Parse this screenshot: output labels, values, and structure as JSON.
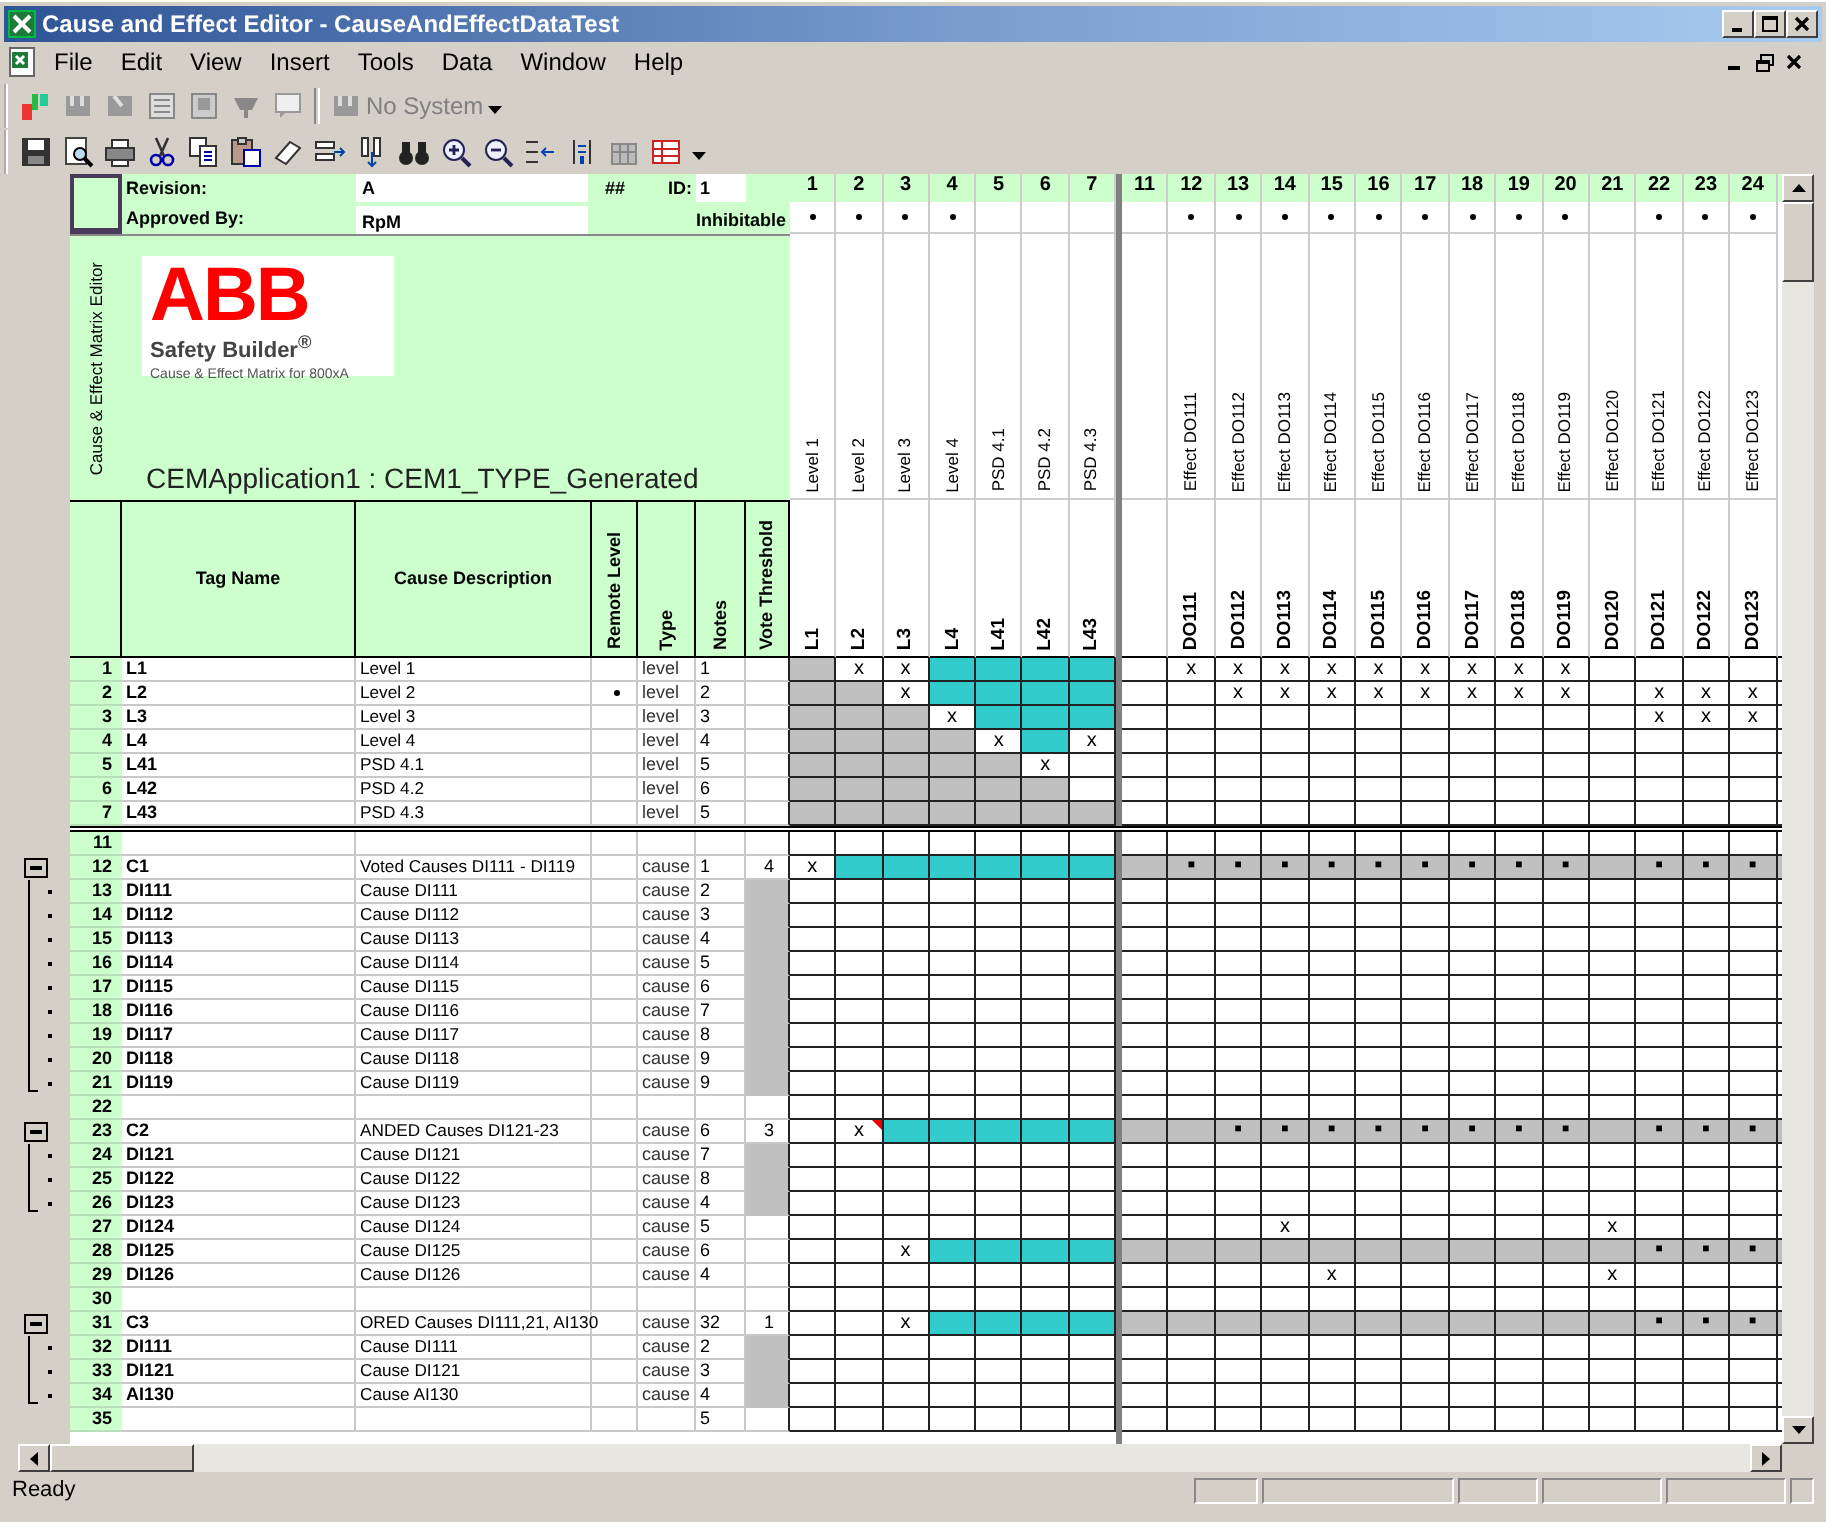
{
  "window": {
    "title": "Cause and Effect Editor - CauseAndEffectDataTest"
  },
  "menu": [
    "File",
    "Edit",
    "View",
    "Insert",
    "Tools",
    "Data",
    "Window",
    "Help"
  ],
  "toolbar": {
    "system_selector": "No System"
  },
  "sheet": {
    "revision_label": "Revision:",
    "revision": "A",
    "hash_mark": "##",
    "id_label": "ID:",
    "id": "1",
    "approved_label": "Approved By:",
    "approved_by": "RpM",
    "inhibitable_label": "Inhibitable",
    "side_caption": "Cause & Effect Matrix Editor",
    "logo": {
      "mark": "ABB",
      "product": "Safety Builder$^{®}$",
      "tagline": "Cause & Effect Matrix for 800xA"
    },
    "application_title": "CEMApplication1 : CEM1_TYPE_Generated",
    "columns": [
      "Tag Name",
      "Cause Description",
      "Remote Level",
      "Type",
      "Notes",
      "Vote Threshold"
    ],
    "cause_columns": [
      {
        "number": "1",
        "inhibitable": true,
        "description": "Level 1",
        "tag": "L1"
      },
      {
        "number": "2",
        "inhibitable": true,
        "description": "Level 2",
        "tag": "L2"
      },
      {
        "number": "3",
        "inhibitable": true,
        "description": "Level 3",
        "tag": "L3"
      },
      {
        "number": "4",
        "inhibitable": true,
        "description": "Level 4",
        "tag": "L4"
      },
      {
        "number": "5",
        "inhibitable": false,
        "description": "PSD 4.1",
        "tag": "L41"
      },
      {
        "number": "6",
        "inhibitable": false,
        "description": "PSD 4.2",
        "tag": "L42"
      },
      {
        "number": "7",
        "inhibitable": false,
        "description": "PSD 4.3",
        "tag": "L43"
      }
    ],
    "effect_columns": [
      {
        "number": "11",
        "inhibitable": false
      },
      {
        "number": "12",
        "inhibitable": true,
        "description": "Effect DO111",
        "tag": "DO111"
      },
      {
        "number": "13",
        "inhibitable": true,
        "description": "Effect DO112",
        "tag": "DO112"
      },
      {
        "number": "14",
        "inhibitable": true,
        "description": "Effect DO113",
        "tag": "DO113"
      },
      {
        "number": "15",
        "inhibitable": true,
        "description": "Effect DO114",
        "tag": "DO114"
      },
      {
        "number": "16",
        "inhibitable": true,
        "description": "Effect DO115",
        "tag": "DO115"
      },
      {
        "number": "17",
        "inhibitable": true,
        "description": "Effect DO116",
        "tag": "DO116"
      },
      {
        "number": "18",
        "inhibitable": true,
        "description": "Effect DO117",
        "tag": "DO117"
      },
      {
        "number": "19",
        "inhibitable": true,
        "description": "Effect DO118",
        "tag": "DO118"
      },
      {
        "number": "20",
        "inhibitable": true,
        "description": "Effect DO119",
        "tag": "DO119"
      },
      {
        "number": "21",
        "inhibitable": false,
        "description": "Effect DO120",
        "tag": "DO120"
      },
      {
        "number": "22",
        "inhibitable": true,
        "description": "Effect DO121",
        "tag": "DO121"
      },
      {
        "number": "23",
        "inhibitable": true,
        "description": "Effect DO122",
        "tag": "DO122"
      },
      {
        "number": "24",
        "inhibitable": true,
        "description": "Effect DO123",
        "tag": "DO123"
      }
    ],
    "level_rows": [
      {
        "number": "1",
        "tag": "L1",
        "description": "Level 1",
        "remote": false,
        "type": "level",
        "notes": "1",
        "vote_shaded": false,
        "effects_shaded": false,
        "cells": [
          {
            "color": "#c0c0c0"
          },
          "x",
          "x",
          {
            "color": "#33cccc"
          },
          {
            "color": "#33cccc"
          },
          {
            "color": "#33cccc"
          },
          {
            "color": "#33cccc"
          },
          null,
          "x",
          "x",
          "x",
          "x",
          "x",
          "x",
          "x",
          "x",
          "x"
        ]
      },
      {
        "number": "2",
        "tag": "L2",
        "description": "Level 2",
        "remote": true,
        "type": "level",
        "notes": "2",
        "vote_shaded": false,
        "effects_shaded": false,
        "cells": [
          {
            "color": "#c0c0c0"
          },
          {
            "color": "#c0c0c0"
          },
          "x",
          {
            "color": "#33cccc"
          },
          {
            "color": "#33cccc"
          },
          {
            "color": "#33cccc"
          },
          {
            "color": "#33cccc"
          },
          null,
          null,
          "x",
          "x",
          "x",
          "x",
          "x",
          "x",
          "x",
          "x",
          null,
          "x",
          "x",
          "x"
        ]
      },
      {
        "number": "3",
        "tag": "L3",
        "description": "Level 3",
        "remote": false,
        "type": "level",
        "notes": "3",
        "vote_shaded": false,
        "effects_shaded": false,
        "cells": [
          {
            "color": "#c0c0c0"
          },
          {
            "color": "#c0c0c0"
          },
          {
            "color": "#c0c0c0"
          },
          "x",
          {
            "color": "#33cccc"
          },
          {
            "color": "#33cccc"
          },
          {
            "color": "#33cccc"
          },
          null,
          null,
          null,
          null,
          null,
          null,
          null,
          null,
          null,
          null,
          null,
          "x",
          "x",
          "x"
        ]
      },
      {
        "number": "4",
        "tag": "L4",
        "description": "Level 4",
        "remote": false,
        "type": "level",
        "notes": "4",
        "vote_shaded": false,
        "effects_shaded": false,
        "cells": [
          {
            "color": "#c0c0c0"
          },
          {
            "color": "#c0c0c0"
          },
          {
            "color": "#c0c0c0"
          },
          {
            "color": "#c0c0c0"
          },
          "x",
          {
            "color": "#33cccc"
          },
          "x"
        ]
      },
      {
        "number": "5",
        "tag": "L41",
        "description": "PSD 4.1",
        "remote": false,
        "type": "level",
        "notes": "5",
        "vote_shaded": false,
        "effects_shaded": false,
        "cells": [
          {
            "color": "#c0c0c0"
          },
          {
            "color": "#c0c0c0"
          },
          {
            "color": "#c0c0c0"
          },
          {
            "color": "#c0c0c0"
          },
          {
            "color": "#c0c0c0"
          },
          "x"
        ]
      },
      {
        "number": "6",
        "tag": "L42",
        "description": "PSD 4.2",
        "remote": false,
        "type": "level",
        "notes": "6",
        "vote_shaded": false,
        "effects_shaded": false,
        "cells": [
          {
            "color": "#c0c0c0"
          },
          {
            "color": "#c0c0c0"
          },
          {
            "color": "#c0c0c0"
          },
          {
            "color": "#c0c0c0"
          },
          {
            "color": "#c0c0c0"
          },
          {
            "color": "#c0c0c0"
          }
        ]
      },
      {
        "number": "7",
        "tag": "L43",
        "description": "PSD 4.3",
        "remote": false,
        "type": "level",
        "notes": "5",
        "vote_shaded": false,
        "effects_shaded": false,
        "cells": [
          {
            "color": "#c0c0c0"
          },
          {
            "color": "#c0c0c0"
          },
          {
            "color": "#c0c0c0"
          },
          {
            "color": "#c0c0c0"
          },
          {
            "color": "#c0c0c0"
          },
          {
            "color": "#c0c0c0"
          },
          {
            "color": "#c0c0c0"
          }
        ]
      }
    ],
    "cause_rows": [
      {
        "number": "11",
        "remote": false,
        "vote_shaded": false,
        "effects_shaded": false
      },
      {
        "number": "12",
        "tag": "C1",
        "description": "Voted Causes DI111 - DI119",
        "remote": false,
        "type": "cause",
        "notes": "1",
        "vote": "4",
        "vote_shaded": false,
        "effects_shaded": true,
        "expanded": true,
        "cells": [
          "x",
          {
            "color": "#33cccc"
          },
          {
            "color": "#33cccc"
          },
          {
            "color": "#33cccc"
          },
          {
            "color": "#33cccc"
          },
          {
            "color": "#33cccc"
          },
          {
            "color": "#33cccc"
          },
          null,
          "■",
          "■",
          "■",
          "■",
          "■",
          "■",
          "■",
          "■",
          "■",
          null,
          "■",
          "■",
          "■"
        ],
        "children": [
          {
            "number": "13",
            "tag": "DI111",
            "description": "Cause DI111",
            "remote": false,
            "type": "cause",
            "notes": "2",
            "vote_shaded": true,
            "effects_shaded": false
          },
          {
            "number": "14",
            "tag": "DI112",
            "description": "Cause DI112",
            "remote": false,
            "type": "cause",
            "notes": "3",
            "vote_shaded": true,
            "effects_shaded": false
          },
          {
            "number": "15",
            "tag": "DI113",
            "description": "Cause DI113",
            "remote": false,
            "type": "cause",
            "notes": "4",
            "vote_shaded": true,
            "effects_shaded": false
          },
          {
            "number": "16",
            "tag": "DI114",
            "description": "Cause DI114",
            "remote": false,
            "type": "cause",
            "notes": "5",
            "vote_shaded": true,
            "effects_shaded": false
          },
          {
            "number": "17",
            "tag": "DI115",
            "description": "Cause DI115",
            "remote": false,
            "type": "cause",
            "notes": "6",
            "vote_shaded": true,
            "effects_shaded": false
          },
          {
            "number": "18",
            "tag": "DI116",
            "description": "Cause DI116",
            "remote": false,
            "type": "cause",
            "notes": "7",
            "vote_shaded": true,
            "effects_shaded": false
          },
          {
            "number": "19",
            "tag": "DI117",
            "description": "Cause DI117",
            "remote": false,
            "type": "cause",
            "notes": "8",
            "vote_shaded": true,
            "effects_shaded": false
          },
          {
            "number": "20",
            "tag": "DI118",
            "description": "Cause DI118",
            "remote": false,
            "type": "cause",
            "notes": "9",
            "vote_shaded": true,
            "effects_shaded": false
          },
          {
            "number": "21",
            "tag": "DI119",
            "description": "Cause DI119",
            "remote": false,
            "type": "cause",
            "notes": "9",
            "vote_shaded": true,
            "effects_shaded": false
          }
        ]
      },
      {
        "number": "22",
        "remote": false,
        "vote_shaded": false,
        "effects_shaded": false
      },
      {
        "number": "23",
        "tag": "C2",
        "description": "ANDED Causes DI121-23",
        "remote": false,
        "type": "cause",
        "notes": "6",
        "vote": "3",
        "vote_shaded": false,
        "effects_shaded": true,
        "expanded": true,
        "cells": [
          null,
          {
            "mark": "x",
            "comment": true
          },
          {
            "color": "#33cccc"
          },
          {
            "color": "#33cccc"
          },
          {
            "color": "#33cccc"
          },
          {
            "color": "#33cccc"
          },
          {
            "color": "#33cccc"
          },
          null,
          null,
          "■",
          "■",
          "■",
          "■",
          "■",
          "■",
          "■",
          "■",
          null,
          "■",
          "■",
          "■"
        ],
        "children": [
          {
            "number": "24",
            "tag": "DI121",
            "description": "Cause DI121",
            "remote": false,
            "type": "cause",
            "notes": "7",
            "vote_shaded": true,
            "effects_shaded": false
          },
          {
            "number": "25",
            "tag": "DI122",
            "description": "Cause DI122",
            "remote": false,
            "type": "cause",
            "notes": "8",
            "vote_shaded": true,
            "effects_shaded": false
          },
          {
            "number": "26",
            "tag": "DI123",
            "description": "Cause DI123",
            "remote": false,
            "type": "cause",
            "notes": "4",
            "vote_shaded": true,
            "effects_shaded": false
          }
        ]
      },
      {
        "number": "27",
        "tag": "DI124",
        "description": "Cause DI124",
        "remote": false,
        "type": "cause",
        "notes": "5",
        "vote_shaded": false,
        "effects_shaded": false,
        "cells": [
          null,
          null,
          null,
          null,
          null,
          null,
          null,
          null,
          null,
          null,
          "x",
          null,
          null,
          null,
          null,
          null,
          null,
          "x"
        ]
      },
      {
        "number": "28",
        "tag": "DI125",
        "description": "Cause DI125",
        "remote": false,
        "type": "cause",
        "notes": "6",
        "vote_shaded": false,
        "effects_shaded": true,
        "cells": [
          null,
          null,
          "x",
          {
            "color": "#33cccc"
          },
          {
            "color": "#33cccc"
          },
          {
            "color": "#33cccc"
          },
          {
            "color": "#33cccc"
          },
          null,
          null,
          null,
          null,
          null,
          null,
          null,
          null,
          null,
          null,
          null,
          "■",
          "■",
          "■"
        ]
      },
      {
        "number": "29",
        "tag": "DI126",
        "description": "Cause DI126",
        "remote": false,
        "type": "cause",
        "notes": "4",
        "vote_shaded": false,
        "effects_shaded": false,
        "cells": [
          null,
          null,
          null,
          null,
          null,
          null,
          null,
          null,
          null,
          null,
          null,
          "x",
          null,
          null,
          null,
          null,
          null,
          "x"
        ]
      },
      {
        "number": "30",
        "remote": false,
        "vote_shaded": false,
        "effects_shaded": false
      },
      {
        "number": "31",
        "tag": "C3",
        "description": "ORED Causes DI111,21, AI130",
        "remote": false,
        "type": "cause",
        "notes": "32",
        "vote": "1",
        "vote_shaded": false,
        "effects_shaded": true,
        "expanded": true,
        "cells": [
          null,
          null,
          "x",
          {
            "color": "#33cccc"
          },
          {
            "color": "#33cccc"
          },
          {
            "color": "#33cccc"
          },
          {
            "color": "#33cccc"
          },
          null,
          null,
          null,
          null,
          null,
          null,
          null,
          null,
          null,
          null,
          null,
          "■",
          "■",
          "■"
        ],
        "children": [
          {
            "number": "32",
            "tag": "DI111",
            "description": "Cause DI111",
            "remote": false,
            "type": "cause",
            "notes": "2",
            "vote_shaded": true,
            "effects_shaded": false
          },
          {
            "number": "33",
            "tag": "DI121",
            "description": "Cause DI121",
            "remote": false,
            "type": "cause",
            "notes": "3",
            "vote_shaded": true,
            "effects_shaded": false
          },
          {
            "number": "34",
            "tag": "AI130",
            "description": "Cause AI130",
            "remote": false,
            "type": "cause",
            "notes": "4",
            "vote_shaded": true,
            "effects_shaded": false
          }
        ]
      },
      {
        "number": "35",
        "notes": "5",
        "remote": false,
        "vote_shaded": false,
        "effects_shaded": false
      }
    ]
  },
  "status_bar": {
    "text": "Ready"
  }
}
